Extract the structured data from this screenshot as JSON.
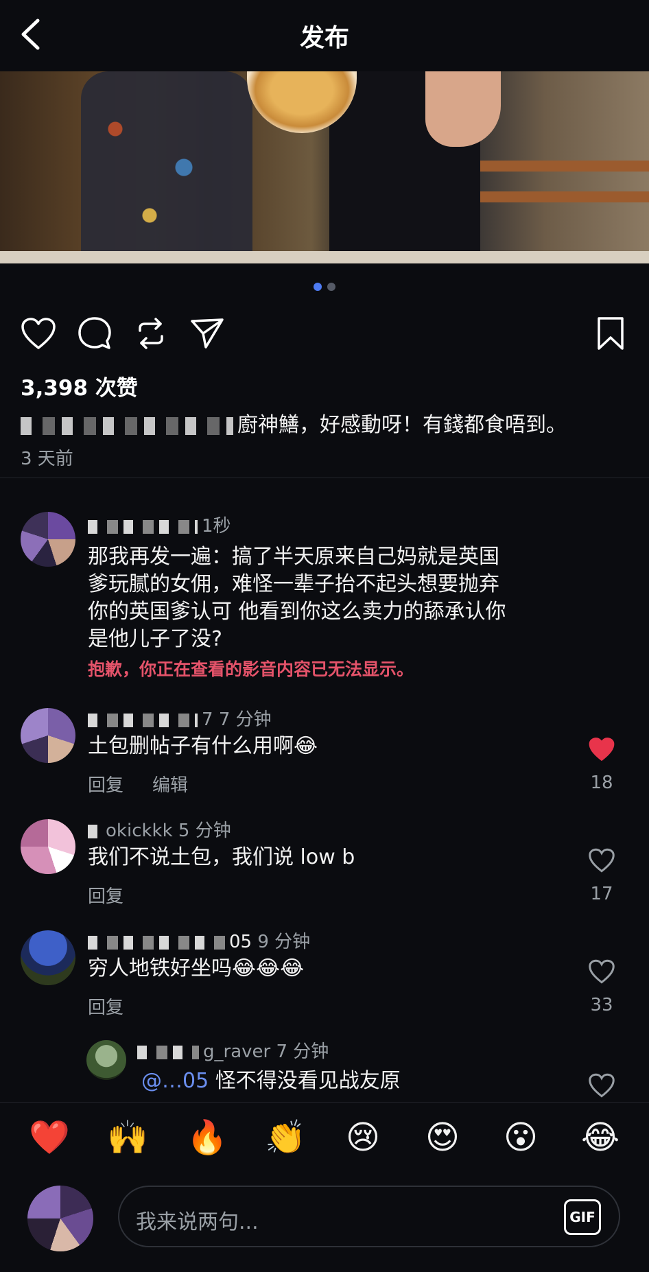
{
  "header": {
    "title": "发布"
  },
  "post": {
    "likes": "3,398 次赞",
    "caption": "廚神鱔，好感動呀！有錢都食唔到。",
    "time": "3 天前",
    "carousel": {
      "count": 2,
      "active": 1
    }
  },
  "comments": [
    {
      "time": "1秒",
      "text_lines": [
        "那我再发一遍：搞了半天原来自己妈就是英国",
        "爹玩腻的女佣，难怪一辈子抬不起头想要抛弃",
        "你的英国爹认可 他看到你这么卖力的舔承认你",
        "是他儿子了没?"
      ],
      "warning": "抱歉，你正在查看的影音内容已无法显示。"
    },
    {
      "user_suffix": "7",
      "time": "7 分钟",
      "text": "土包删帖子有什么用啊😂",
      "actions": [
        "回复",
        "编辑"
      ],
      "likes": "18",
      "liked": true
    },
    {
      "user_suffix": "okickkk",
      "time": "5 分钟",
      "text": "我们不说土包，我们说 low b",
      "actions": [
        "回复"
      ],
      "likes": "17",
      "liked": false
    },
    {
      "user_suffix": "05",
      "time": "9 分钟",
      "text": "穷人地铁好坐吗😂😂😂",
      "actions": [
        "回复"
      ],
      "likes": "33",
      "liked": false
    },
    {
      "user_suffix": "g_raver",
      "time": "7 分钟",
      "mention": "@…05",
      "text": "怪不得没看见战友原",
      "liked": false
    }
  ],
  "emoji_bar": [
    "❤️",
    "🙌",
    "🔥",
    "👏",
    "😢",
    "😍",
    "😮",
    "😂"
  ],
  "input": {
    "placeholder": "我来说两句...",
    "gif_label": "GIF"
  },
  "colors": {
    "accent": "#4e7bf2",
    "liked": "#e8344b",
    "warning": "#e5536a",
    "background": "#0b0c10"
  }
}
